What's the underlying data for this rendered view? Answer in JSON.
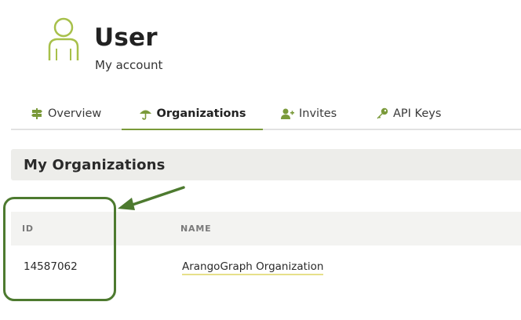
{
  "header": {
    "icon": "user-icon",
    "title": "User",
    "subtitle": "My account"
  },
  "tabs": [
    {
      "label": "Overview",
      "icon": "signpost-icon",
      "active": false
    },
    {
      "label": "Organizations",
      "icon": "umbrella-icon",
      "active": true
    },
    {
      "label": "Invites",
      "icon": "user-plus-icon",
      "active": false
    },
    {
      "label": "API Keys",
      "icon": "key-icon",
      "active": false
    }
  ],
  "section": {
    "title": "My Organizations"
  },
  "table": {
    "columns": [
      "ID",
      "NAME"
    ],
    "rows": [
      {
        "id": "14587062",
        "name": "ArangoGraph Organization"
      }
    ]
  },
  "colors": {
    "accent": "#7a9a3a",
    "annotation": "#4d7a2f",
    "link_underline": "#e6e08a"
  }
}
